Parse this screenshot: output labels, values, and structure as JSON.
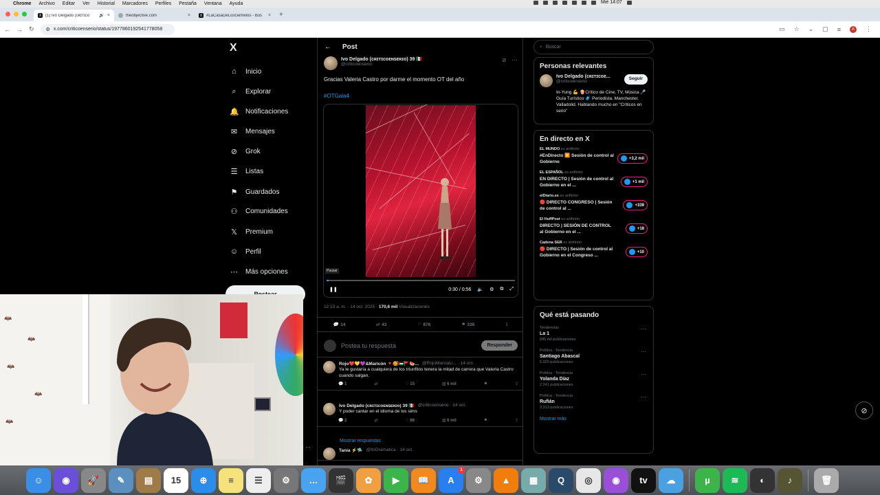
{
  "menubar": {
    "app": "Chrome",
    "items": [
      "Archivo",
      "Editar",
      "Ver",
      "Historial",
      "Marcadores",
      "Perfiles",
      "Pestaña",
      "Ventana",
      "Ayuda"
    ],
    "clock": "Mié 14:07"
  },
  "tabs": [
    {
      "title": "(1) Ivo Delgado (ᴄʀɪᴛɪᴄᴏ",
      "favicon": "X"
    },
    {
      "title": "theobjective.com",
      "favicon": "globe"
    },
    {
      "title": "#LaCasaDeLosGemelos - Bus",
      "favicon": "X"
    }
  ],
  "address": {
    "url": "x.com/criticoenserio/status/1977860192541778058"
  },
  "nav": {
    "logo": "X",
    "items": [
      {
        "label": "Inicio",
        "icon": "home-icon",
        "glyph": "⌂"
      },
      {
        "label": "Explorar",
        "icon": "search-icon",
        "glyph": "⌕"
      },
      {
        "label": "Notificaciones",
        "icon": "bell-icon",
        "glyph": "🔔"
      },
      {
        "label": "Mensajes",
        "icon": "mail-icon",
        "glyph": "✉"
      },
      {
        "label": "Grok",
        "icon": "grok-icon",
        "glyph": "⊘"
      },
      {
        "label": "Listas",
        "icon": "list-icon",
        "glyph": "☰"
      },
      {
        "label": "Guardados",
        "icon": "bookmark-icon",
        "glyph": "⚑"
      },
      {
        "label": "Comunidades",
        "icon": "people-icon",
        "glyph": "⚇"
      },
      {
        "label": "Premium",
        "icon": "x-premium-icon",
        "glyph": "𝕏"
      },
      {
        "label": "Perfil",
        "icon": "person-icon",
        "glyph": "☺"
      },
      {
        "label": "Más opciones",
        "icon": "more-icon",
        "glyph": "⋯"
      }
    ],
    "post_button": "Postear"
  },
  "post": {
    "header": "Post",
    "author_name": "Ivo Delgado (ᴄʀɪᴛɪᴄᴏᴇɴꜱᴇʀɪᴏ) 39 🇲🇽",
    "author_handle": "@criticoenserio",
    "text": "Gracias Valeria Castro por darme el momento OT del año",
    "hashtag": "#OTGala4",
    "video": {
      "pause_label": "Pausar",
      "time": "0:30 / 0:56",
      "progress": 0.01
    },
    "meta_time": "12:13 a. m. · 14 oct. 2025 · ",
    "views": "170,6 mil",
    "views_label": " Visualizaciones",
    "stats": {
      "replies": "14",
      "reposts": "43",
      "likes": "876",
      "bookmarks": "338"
    },
    "reply_placeholder": "Postea tu respuesta",
    "reply_button": "Responder"
  },
  "comments": [
    {
      "name": "Rojo❤️💛💜&Maricón 🔻🥰🇵🇸🚩🍉...",
      "handle": "@RojoMaricaLi... · 14 oct.",
      "text": "Ya le gustaría a cualquiera de los triunfitos tenera la mitad de carrera que Valeria Castro cuando salgan.",
      "replies": "1",
      "reposts": "",
      "likes": "15",
      "views": "6 mil"
    },
    {
      "name": "Ivo Delgado (ᴄʀɪᴛɪᴄᴏᴇɴꜱᴇʀɪᴏ) 39 🇲🇽",
      "handle": "@criticoenserio · 14 oct.",
      "text": "Y poder cantar en el idioma de los sims",
      "replies": "2",
      "reposts": "",
      "likes": "88",
      "views": "6 mil"
    },
    {
      "name": "Tania ⚡🛸",
      "handle": "@ItsDramatica · 14 oct.",
      "text": "",
      "replies": "",
      "reposts": "",
      "likes": "",
      "views": ""
    }
  ],
  "show_replies": "Mostrar respuestas",
  "right": {
    "search_placeholder": "Buscar",
    "relevant_title": "Personas relevantes",
    "person": {
      "name": "Ivo Delgado (ᴄʀɪᴛɪᴄᴏᴇ...",
      "handle": "@criticoenserio",
      "follow": "Seguir",
      "bio": "In-Yung 💪 🍿Crítico de Cine, TV, Música 🎤 Guía Turístico 🧳 Periodista. Manchester. Valladolid. Hablando mucho en \"Críticos en serio\""
    },
    "live_title": "En directo en X",
    "live": [
      {
        "host": "EL MUNDO",
        "suffix": " es anfitrión",
        "title": "#EnDirecto ▶️ Sesión de control al Gobierno",
        "count": "+3,2 mil"
      },
      {
        "host": "EL ESPAÑOL",
        "suffix": " es anfitrión",
        "title": "EN DIRECTO | Sesión de control al Gobierno en el ...",
        "count": "+1 mil"
      },
      {
        "host": "elDiario.es",
        "suffix": " es anfitrión",
        "title": "🔴 DIRECTO CONGRESO | Sesión de control al ...",
        "count": "+339"
      },
      {
        "host": "El HuffPost",
        "suffix": " es anfitrión",
        "title": "DIRECTO | SESIÓN DE CONTROL al Gobierno en el ...",
        "count": "+18"
      },
      {
        "host": "Cadena SER",
        "suffix": " es anfitrión",
        "title": "🔴 DIRECTO | Sesión de control al Gobierno en el Congreso ...",
        "count": "+10"
      }
    ],
    "trends_title": "Qué está pasando",
    "trends": [
      {
        "cat": "Tendencias",
        "name": "La 1",
        "count": "295 mil publicaciones"
      },
      {
        "cat": "Política · Tendencia",
        "name": "Santiago Abascal",
        "count": "5.920 publicaciones"
      },
      {
        "cat": "Política · Tendencia",
        "name": "Yolanda Díaz",
        "count": "2.241 publicaciones"
      },
      {
        "cat": "Política · Tendencia",
        "name": "Rufián",
        "count": "3.313 publicaciones"
      }
    ],
    "show_more": "Mostrar más"
  },
  "dock": {
    "apps": [
      {
        "name": "finder",
        "color": "#3a8ee6",
        "glyph": "☺"
      },
      {
        "name": "siri",
        "color": "#6b4fd8",
        "glyph": "◉"
      },
      {
        "name": "launchpad",
        "color": "#888",
        "glyph": "🚀"
      },
      {
        "name": "preview",
        "color": "#5a8fc0",
        "glyph": "✎"
      },
      {
        "name": "notebook",
        "color": "#a07b4a",
        "glyph": "▤"
      },
      {
        "name": "calendar",
        "color": "#fff",
        "glyph": "15"
      },
      {
        "name": "safari",
        "color": "#2b8de8",
        "glyph": "⊕"
      },
      {
        "name": "notes",
        "color": "#f5e27a",
        "glyph": "≡"
      },
      {
        "name": "reminders",
        "color": "#eee",
        "glyph": "☰"
      },
      {
        "name": "utilities",
        "color": "#777",
        "glyph": "⚙"
      },
      {
        "name": "messages-bubble",
        "color": "#4aa3f0",
        "glyph": "…"
      },
      {
        "name": "final-cut",
        "color": "#333",
        "glyph": "🎬"
      },
      {
        "name": "photos",
        "color": "#f0a040",
        "glyph": "✿"
      },
      {
        "name": "facetime",
        "color": "#3cb44a",
        "glyph": "▶"
      },
      {
        "name": "books",
        "color": "#f08a1e",
        "glyph": "📖"
      },
      {
        "name": "app-store",
        "color": "#2a7ff0",
        "glyph": "A"
      },
      {
        "name": "system-settings",
        "color": "#888",
        "glyph": "⚙"
      },
      {
        "name": "vlc",
        "color": "#f07d0c",
        "glyph": "▲"
      },
      {
        "name": "image-app",
        "color": "#7aa",
        "glyph": "▦"
      },
      {
        "name": "quicktime",
        "color": "#2a4a6a",
        "glyph": "Q"
      },
      {
        "name": "chrome",
        "color": "#e7e7e7",
        "glyph": "◎"
      },
      {
        "name": "podcasts",
        "color": "#9b4fd8",
        "glyph": "◉"
      },
      {
        "name": "apple-tv",
        "color": "#111",
        "glyph": "tv"
      },
      {
        "name": "cloud-app",
        "color": "#4aa0e0",
        "glyph": "☁"
      },
      {
        "name": "utorrent",
        "color": "#3cb44a",
        "glyph": "µ"
      },
      {
        "name": "spotify",
        "color": "#1db954",
        "glyph": "≋"
      },
      {
        "name": "obs",
        "color": "#333",
        "glyph": "◐"
      },
      {
        "name": "album",
        "color": "#553",
        "glyph": "♪"
      },
      {
        "name": "trash",
        "color": "#aaa",
        "glyph": "🗑"
      }
    ],
    "calendar_month": "OCT",
    "app_store_badge": "1"
  },
  "colors": {
    "accent": "#1d9bf0",
    "live_border": "#f91880",
    "bg": "#000000"
  }
}
